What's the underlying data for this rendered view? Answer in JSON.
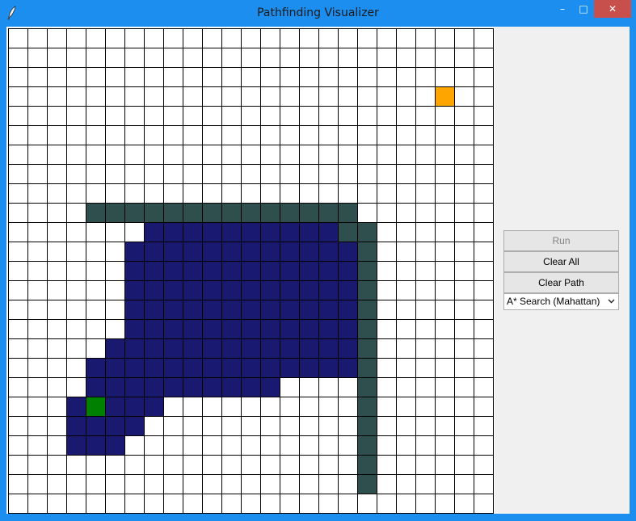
{
  "window": {
    "title": "Pathfinding Visualizer",
    "minimize_glyph": "–",
    "maximize_glyph": "□",
    "close_glyph": "✕"
  },
  "grid": {
    "cols": 25,
    "rows": 25,
    "colors": {
      "empty": "#ffffff",
      "line": "#000000",
      "wall": "#2f4f4f",
      "explored": "#191970",
      "start": "#008000",
      "end": "#ffa500"
    },
    "start": [
      4,
      19
    ],
    "end": [
      22,
      3
    ],
    "walls": [
      [
        [
          4,
          9
        ],
        [
          17,
          9
        ]
      ],
      [
        [
          17,
          10
        ],
        [
          18,
          10
        ]
      ],
      [
        [
          18,
          11
        ],
        [
          18,
          23
        ]
      ]
    ],
    "explored": [
      [
        10,
        7,
        16
      ],
      [
        11,
        6,
        17
      ],
      [
        12,
        6,
        17
      ],
      [
        13,
        6,
        17
      ],
      [
        14,
        6,
        17
      ],
      [
        15,
        6,
        17
      ],
      [
        16,
        5,
        17
      ],
      [
        17,
        4,
        17
      ],
      [
        18,
        4,
        13
      ],
      [
        19,
        3,
        7
      ],
      [
        20,
        3,
        6
      ],
      [
        21,
        3,
        5
      ]
    ]
  },
  "controls": {
    "run_label": "Run",
    "clear_all_label": "Clear All",
    "clear_path_label": "Clear Path",
    "algorithm_selected": "A* Search (Mahattan)"
  }
}
